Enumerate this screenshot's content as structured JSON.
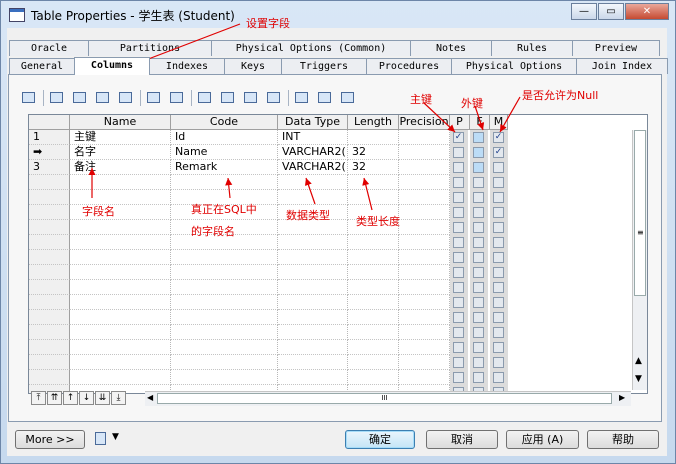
{
  "window": {
    "title": "Table Properties - 学生表 (Student)",
    "min_glyph": "—",
    "restore_glyph": "▭",
    "close_glyph": "✕"
  },
  "tabs_top": [
    "Oracle",
    "Partitions",
    "Physical Options (Common)",
    "Notes",
    "Rules",
    "Preview"
  ],
  "tabs_bottom": [
    "General",
    "Columns",
    "Indexes",
    "Keys",
    "Triggers",
    "Procedures",
    "Physical Options",
    "Join Index"
  ],
  "active_tab": "Columns",
  "toolbar_icons": [
    "properties-icon",
    "add-row-icon",
    "insert-row-icon",
    "add-rows-icon",
    "copy-rows-icon",
    "new-attribute-icon",
    "attribute-icon",
    "cut-icon",
    "copy-icon",
    "paste-icon",
    "delete-icon",
    "find-icon",
    "filter-icon",
    "filter-options-icon"
  ],
  "grid": {
    "headers": {
      "name": "Name",
      "code": "Code",
      "datatype": "Data Type",
      "length": "Length",
      "precision": "Precision",
      "p": "P",
      "f": "F",
      "m": "M"
    },
    "rows": [
      {
        "marker": "1",
        "name": "主键",
        "code": "Id",
        "datatype": "INT",
        "length": "",
        "p": true,
        "f": false,
        "m": true
      },
      {
        "marker": "➡",
        "name": "名字",
        "code": "Name",
        "datatype": "VARCHAR2(",
        "length": "32",
        "p": false,
        "f": false,
        "m": true
      },
      {
        "marker": "3",
        "name": "备注",
        "code": "Remark",
        "datatype": "VARCHAR2(",
        "length": "32",
        "p": false,
        "f": false,
        "m": false
      }
    ],
    "check_mark": "✓"
  },
  "annotations": {
    "set_field": "设置字段",
    "primary_key": "主键",
    "foreign_key": "外键",
    "nullable": "是否允许为Null",
    "field_name": "字段名",
    "sql_name_1": "真正在SQL中",
    "sql_name_2": "的字段名",
    "data_type": "数据类型",
    "type_length": "类型长度"
  },
  "nav_buttons": [
    "⤒",
    "⇈",
    "↑",
    "↓",
    "⇊",
    "⤓"
  ],
  "vscroll_glyphs": [
    "▲",
    "▼",
    "≡"
  ],
  "hscroll_glyphs": [
    "◀",
    "▶",
    "III"
  ],
  "buttons": {
    "more": "More >>",
    "ok": "确定",
    "cancel": "取消",
    "apply": "应用 (A)",
    "help": "帮助"
  },
  "colors": {
    "annotation": "#e00000",
    "accent": "#3c7fb1"
  }
}
